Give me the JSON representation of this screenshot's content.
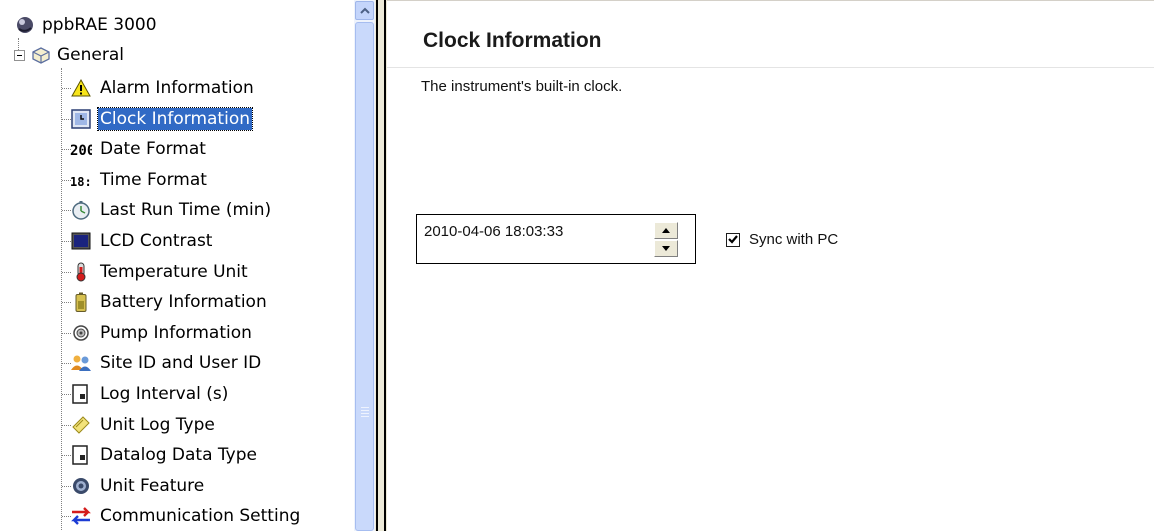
{
  "tree": {
    "root_label": "ppbRAE 3000",
    "general_label": "General",
    "items": [
      {
        "label": "Alarm Information",
        "icon": "warning-icon"
      },
      {
        "label": "Clock Information",
        "icon": "clock-icon",
        "selected": true
      },
      {
        "label": "Date Format",
        "icon": "date-format-icon"
      },
      {
        "label": "Time Format",
        "icon": "time-format-icon"
      },
      {
        "label": "Last Run Time (min)",
        "icon": "stopwatch-icon"
      },
      {
        "label": "LCD Contrast",
        "icon": "lcd-icon"
      },
      {
        "label": "Temperature Unit",
        "icon": "thermometer-icon"
      },
      {
        "label": "Battery Information",
        "icon": "battery-icon"
      },
      {
        "label": "Pump Information",
        "icon": "pump-icon"
      },
      {
        "label": "Site ID and User ID",
        "icon": "users-icon"
      },
      {
        "label": "Log Interval (s)",
        "icon": "log-icon"
      },
      {
        "label": "Unit Log Type",
        "icon": "pencil-icon"
      },
      {
        "label": "Datalog Data Type",
        "icon": "datalog-icon"
      },
      {
        "label": "Unit Feature",
        "icon": "gear-icon"
      },
      {
        "label": "Communication Setting",
        "icon": "exchange-arrows-icon"
      }
    ]
  },
  "panel": {
    "title": "Clock Information",
    "description": "The instrument's built-in clock.",
    "datetime_value": "2010-04-06 18:03:33",
    "sync_label": "Sync with PC",
    "sync_checked": true
  },
  "colors": {
    "selection": "#316ac5",
    "scrollbar": "#c9d9fb",
    "splitter": "#ece9d8"
  }
}
